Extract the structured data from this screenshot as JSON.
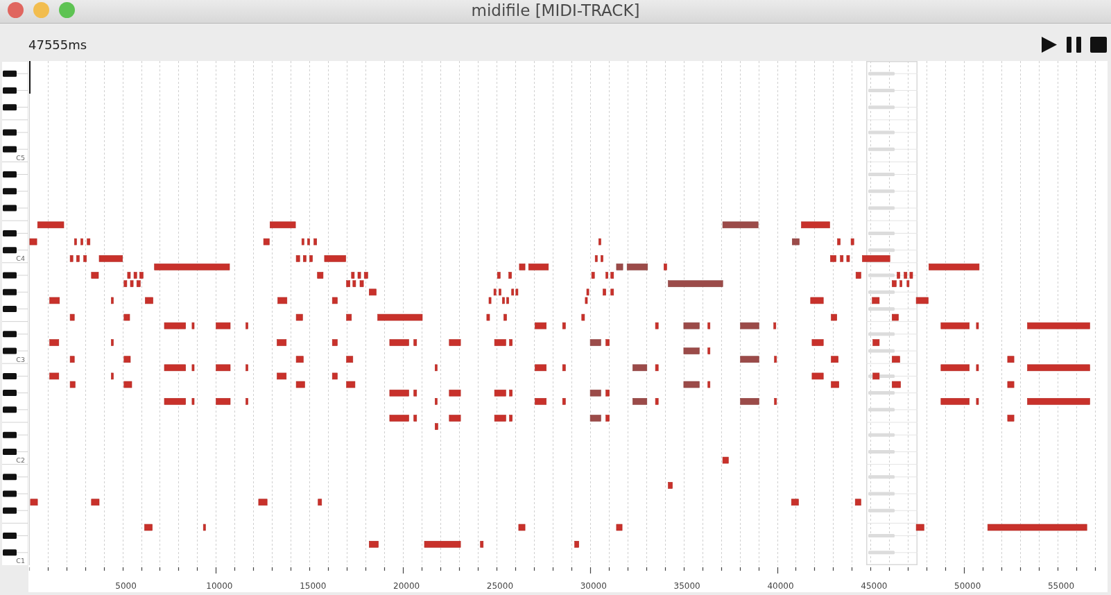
{
  "window": {
    "title": "midifile [MIDI-TRACK]"
  },
  "transport": {
    "position": "47555ms"
  },
  "keyboard": {
    "octave_labels": [
      "C5",
      "C4",
      "C3",
      "C2",
      "C1"
    ]
  },
  "time_axis": {
    "labels": [
      "5000",
      "10000",
      "15000",
      "20000",
      "25000",
      "30000",
      "35000",
      "40000",
      "45000",
      "50000",
      "55000"
    ]
  }
}
